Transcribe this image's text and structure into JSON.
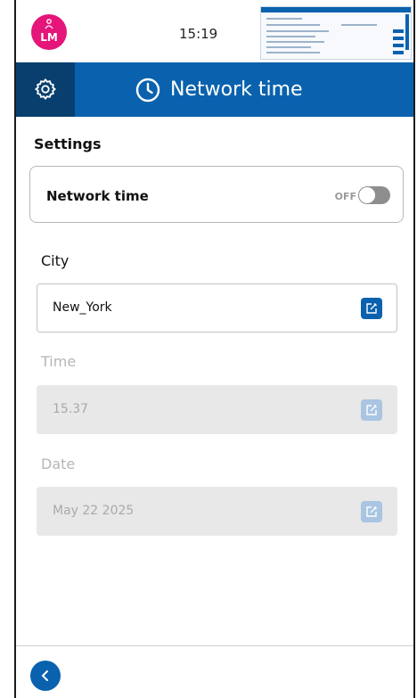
{
  "status": {
    "avatar_initials": "LM",
    "time": "15:19"
  },
  "header": {
    "title": "Network time",
    "icons": [
      "gear-icon",
      "clock-icon"
    ]
  },
  "settings": {
    "section_title": "Settings",
    "network_time": {
      "label": "Network time",
      "toggle_text": "OFF",
      "enabled": false
    }
  },
  "fields": [
    {
      "label": "City",
      "value": "New_York",
      "state": "active"
    },
    {
      "label": "Time",
      "value": "15.37",
      "state": "disabled"
    },
    {
      "label": "Date",
      "value": "May 22 2025",
      "state": "disabled"
    }
  ],
  "colors": {
    "primary": "#0a62ae",
    "header_dark": "#083f6e",
    "avatar": "#e5157a"
  },
  "footer": {
    "back_icon": "chevron-left-icon"
  }
}
